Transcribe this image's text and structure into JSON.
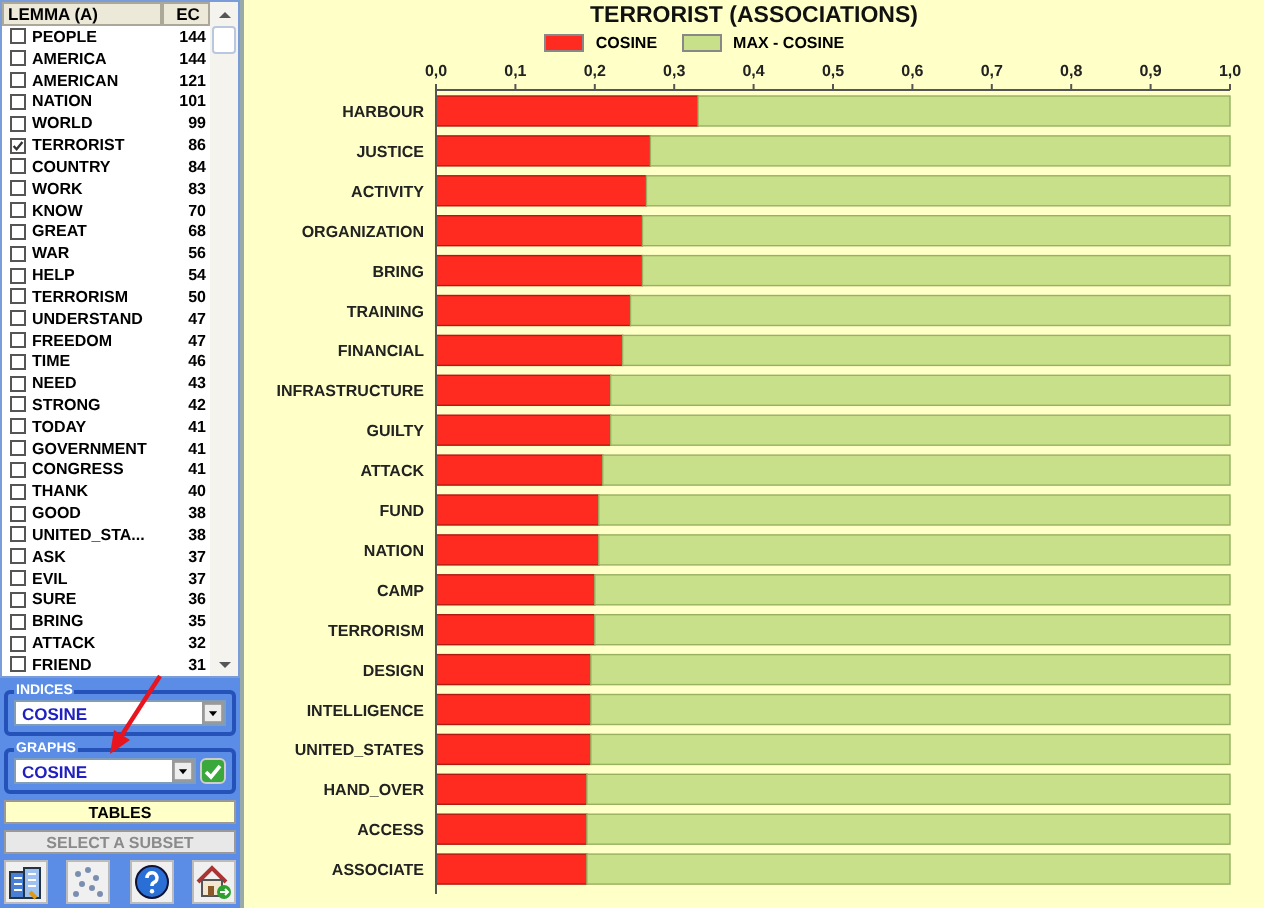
{
  "lemma_list": {
    "columns": [
      "LEMMA (A)",
      "EC"
    ],
    "rows": [
      {
        "lemma": "PEOPLE",
        "ec": "144",
        "checked": false
      },
      {
        "lemma": "AMERICA",
        "ec": "144",
        "checked": false
      },
      {
        "lemma": "AMERICAN",
        "ec": "121",
        "checked": false
      },
      {
        "lemma": "NATION",
        "ec": "101",
        "checked": false
      },
      {
        "lemma": "WORLD",
        "ec": "99",
        "checked": false
      },
      {
        "lemma": "TERRORIST",
        "ec": "86",
        "checked": true
      },
      {
        "lemma": "COUNTRY",
        "ec": "84",
        "checked": false
      },
      {
        "lemma": "WORK",
        "ec": "83",
        "checked": false
      },
      {
        "lemma": "KNOW",
        "ec": "70",
        "checked": false
      },
      {
        "lemma": "GREAT",
        "ec": "68",
        "checked": false
      },
      {
        "lemma": "WAR",
        "ec": "56",
        "checked": false
      },
      {
        "lemma": "HELP",
        "ec": "54",
        "checked": false
      },
      {
        "lemma": "TERRORISM",
        "ec": "50",
        "checked": false
      },
      {
        "lemma": "UNDERSTAND",
        "ec": "47",
        "checked": false
      },
      {
        "lemma": "FREEDOM",
        "ec": "47",
        "checked": false
      },
      {
        "lemma": "TIME",
        "ec": "46",
        "checked": false
      },
      {
        "lemma": "NEED",
        "ec": "43",
        "checked": false
      },
      {
        "lemma": "STRONG",
        "ec": "42",
        "checked": false
      },
      {
        "lemma": "TODAY",
        "ec": "41",
        "checked": false
      },
      {
        "lemma": "GOVERNMENT",
        "ec": "41",
        "checked": false
      },
      {
        "lemma": "CONGRESS",
        "ec": "41",
        "checked": false
      },
      {
        "lemma": "THANK",
        "ec": "40",
        "checked": false
      },
      {
        "lemma": "GOOD",
        "ec": "38",
        "checked": false
      },
      {
        "lemma": "UNITED_STA...",
        "ec": "38",
        "checked": false
      },
      {
        "lemma": "ASK",
        "ec": "37",
        "checked": false
      },
      {
        "lemma": "EVIL",
        "ec": "37",
        "checked": false
      },
      {
        "lemma": "SURE",
        "ec": "36",
        "checked": false
      },
      {
        "lemma": "BRING",
        "ec": "35",
        "checked": false
      },
      {
        "lemma": "ATTACK",
        "ec": "32",
        "checked": false
      },
      {
        "lemma": "FRIEND",
        "ec": "31",
        "checked": false
      }
    ]
  },
  "indices": {
    "label": "INDICES",
    "value": "COSINE"
  },
  "graphs": {
    "label": "GRAPHS",
    "value": "COSINE"
  },
  "buttons": [
    {
      "label": "TABLES",
      "disabled": false
    },
    {
      "label": "SELECT A SUBSET",
      "disabled": true
    }
  ],
  "chart": {
    "title": "TERRORIST (ASSOCIATIONS)",
    "chart_data": {
      "type": "bar",
      "orientation": "horizontal",
      "stacked": true,
      "categories": [
        "HARBOUR",
        "JUSTICE",
        "ACTIVITY",
        "ORGANIZATION",
        "BRING",
        "TRAINING",
        "FINANCIAL",
        "INFRASTRUCTURE",
        "GUILTY",
        "ATTACK",
        "FUND",
        "NATION",
        "CAMP",
        "TERRORISM",
        "DESIGN",
        "INTELLIGENCE",
        "UNITED_STATES",
        "HAND_OVER",
        "ACCESS",
        "ASSOCIATE"
      ],
      "series": [
        {
          "name": "COSINE",
          "color": "#ff2a20",
          "values": [
            0.33,
            0.27,
            0.265,
            0.26,
            0.26,
            0.245,
            0.235,
            0.22,
            0.22,
            0.21,
            0.205,
            0.205,
            0.2,
            0.2,
            0.195,
            0.195,
            0.195,
            0.19,
            0.19,
            0.19
          ]
        },
        {
          "name": "MAX - COSINE",
          "color": "#c8e08a",
          "values": [
            0.67,
            0.73,
            0.735,
            0.74,
            0.74,
            0.755,
            0.765,
            0.78,
            0.78,
            0.79,
            0.795,
            0.795,
            0.8,
            0.8,
            0.805,
            0.805,
            0.805,
            0.81,
            0.81,
            0.81
          ]
        }
      ],
      "xlim": [
        0,
        1
      ],
      "xticks": [
        {
          "value": 0,
          "label": "0,0"
        },
        {
          "value": 0.1,
          "label": "0,1"
        },
        {
          "value": 0.2,
          "label": "0,2"
        },
        {
          "value": 0.3,
          "label": "0,3"
        },
        {
          "value": 0.4,
          "label": "0,4"
        },
        {
          "value": 0.5,
          "label": "0,5"
        },
        {
          "value": 0.6,
          "label": "0,6"
        },
        {
          "value": 0.7,
          "label": "0,7"
        },
        {
          "value": 0.8,
          "label": "0,8"
        },
        {
          "value": 0.9,
          "label": "0,9"
        },
        {
          "value": 1,
          "label": "1,0"
        }
      ]
    }
  }
}
